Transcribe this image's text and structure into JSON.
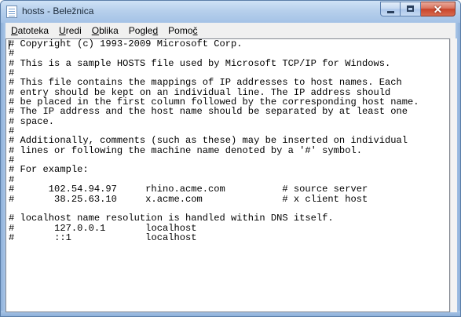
{
  "window": {
    "title": "hosts - Beležnica",
    "icon": "notepad-icon"
  },
  "caption_buttons": {
    "minimize": "minimize-icon",
    "maximize": "maximize-icon",
    "close_glyph": "✕"
  },
  "menu": {
    "items": [
      {
        "first": "D",
        "rest": "atoteka"
      },
      {
        "first": "U",
        "rest": "redi"
      },
      {
        "first": "O",
        "rest": "blika"
      },
      {
        "first": "",
        "rest": "Pogle",
        "tail_u": "d",
        "tail": ""
      },
      {
        "first": "",
        "rest": "Pomo",
        "tail_u": "č",
        "tail": ""
      }
    ]
  },
  "editor": {
    "content": "# Copyright (c) 1993-2009 Microsoft Corp.\n#\n# This is a sample HOSTS file used by Microsoft TCP/IP for Windows.\n#\n# This file contains the mappings of IP addresses to host names. Each\n# entry should be kept on an individual line. The IP address should\n# be placed in the first column followed by the corresponding host name.\n# The IP address and the host name should be separated by at least one\n# space.\n#\n# Additionally, comments (such as these) may be inserted on individual\n# lines or following the machine name denoted by a '#' symbol.\n#\n# For example:\n#\n#      102.54.94.97     rhino.acme.com          # source server\n#       38.25.63.10     x.acme.com              # x client host\n\n# localhost name resolution is handled within DNS itself.\n#\t127.0.0.1       localhost\n#\t::1             localhost"
  }
}
